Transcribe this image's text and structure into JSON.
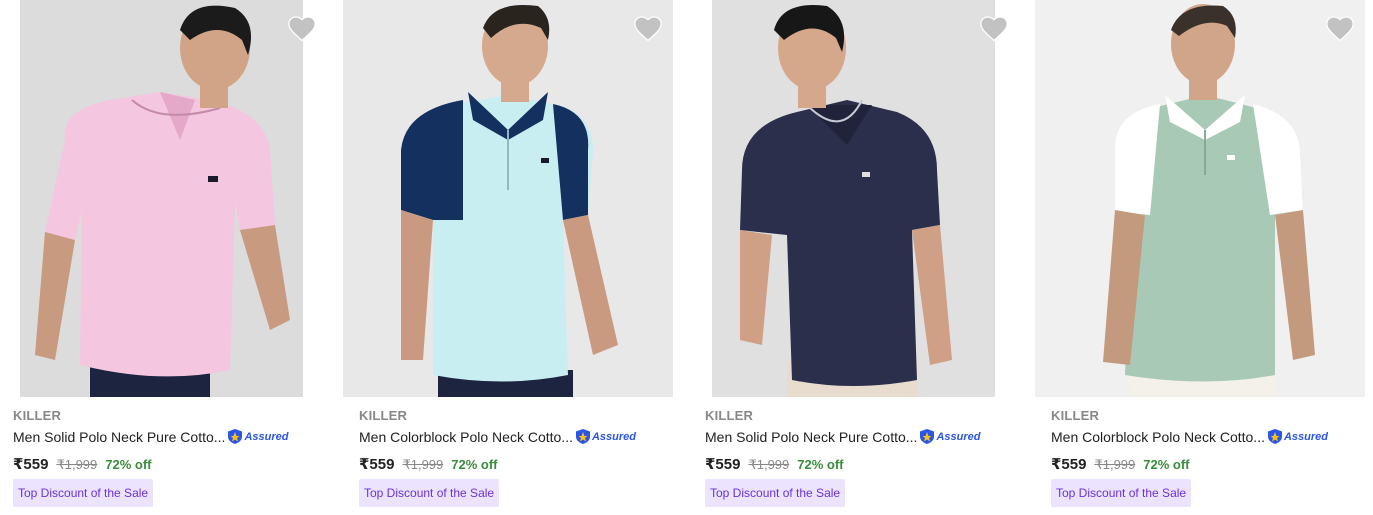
{
  "colors": {
    "accent_green": "#388e3c",
    "tag_bg": "#ece4ff",
    "tag_text": "#6a31d8",
    "assured_blue": "#2a55e5",
    "muted": "#878787"
  },
  "products": [
    {
      "brand": "KILLER",
      "title": "Men Solid Polo Neck Pure Cotto...",
      "assured_label": "Assured",
      "price": "₹559",
      "mrp": "₹1,999",
      "discount": "72% off",
      "tag": "Top Discount of the Sale",
      "shirt_color": "#f4c6e0",
      "accent_color": "#e4a9c9",
      "bg_color": "#dcdcdc",
      "icon": "heart-icon"
    },
    {
      "brand": "KILLER",
      "title": "Men Colorblock Polo Neck Cotto...",
      "assured_label": "Assured",
      "price": "₹559",
      "mrp": "₹1,999",
      "discount": "72% off",
      "tag": "Top Discount of the Sale",
      "shirt_color": "#c8eef2",
      "accent_color": "#13305f",
      "bg_color": "#e8e8e8",
      "icon": "heart-icon"
    },
    {
      "brand": "KILLER",
      "title": "Men Solid Polo Neck Pure Cotto...",
      "assured_label": "Assured",
      "price": "₹559",
      "mrp": "₹1,999",
      "discount": "72% off",
      "tag": "Top Discount of the Sale",
      "shirt_color": "#2c2f4b",
      "accent_color": "#202339",
      "bg_color": "#e0e0e0",
      "icon": "heart-icon"
    },
    {
      "brand": "KILLER",
      "title": "Men Colorblock Polo Neck Cotto...",
      "assured_label": "Assured",
      "price": "₹559",
      "mrp": "₹1,999",
      "discount": "72% off",
      "tag": "Top Discount of the Sale",
      "shirt_color": "#a9c9b7",
      "accent_color": "#ffffff",
      "bg_color": "#f0f0f0",
      "icon": "heart-icon"
    }
  ]
}
